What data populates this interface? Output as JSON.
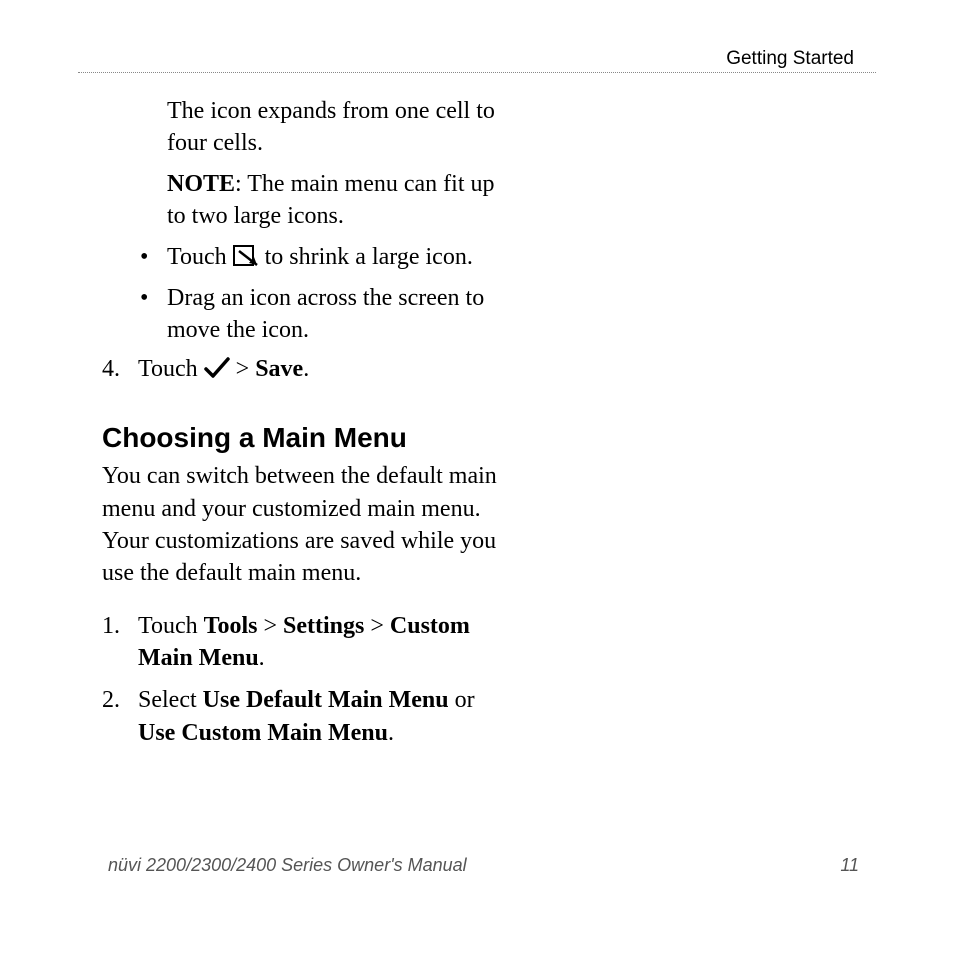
{
  "header": {
    "section_label": "Getting Started"
  },
  "continuation": {
    "expand_text": "The icon expands from one cell to four cells.",
    "note_label": "NOTE",
    "note_text": ": The main menu can fit up to two large icons.",
    "bullet1_before": "Touch ",
    "bullet1_after": " to shrink a large icon.",
    "bullet2": "Drag an icon across the screen to move the icon."
  },
  "step4": {
    "num": "4.",
    "before": "Touch ",
    "gt": " > ",
    "save": "Save",
    "period": "."
  },
  "section": {
    "title": "Choosing a Main Menu",
    "intro": "You can switch between the default main menu and your customized main menu. Your customizations are saved while you use the default main menu."
  },
  "steps": [
    {
      "num": "1.",
      "pre": "Touch ",
      "b1": "Tools",
      "gt1": " > ",
      "b2": "Settings",
      "gt2": " > ",
      "b3": "Custom Main Menu",
      "post": "."
    },
    {
      "num": "2.",
      "pre": "Select ",
      "b1": "Use Default Main Menu",
      "mid": " or ",
      "b2": "Use Custom Main Menu",
      "post": "."
    }
  ],
  "footer": {
    "manual_title": "nüvi 2200/2300/2400 Series Owner's Manual",
    "page_number": "11"
  }
}
